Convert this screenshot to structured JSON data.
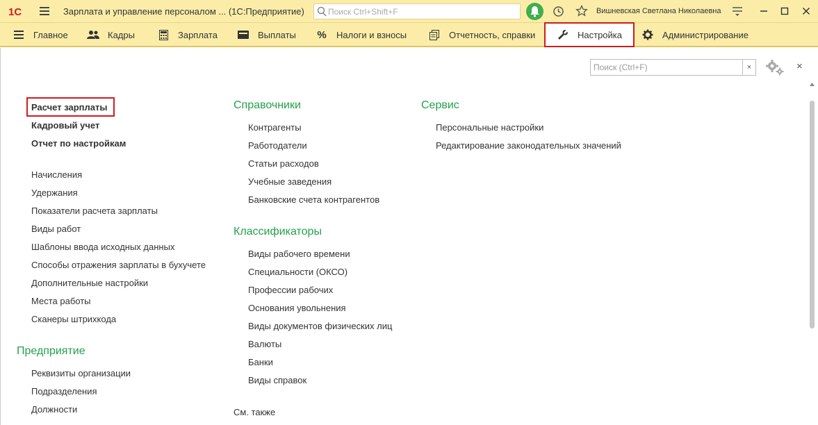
{
  "titlebar": {
    "logo_text": "1С",
    "app_title": "Зарплата и управление персоналом ...  (1С:Предприятие)",
    "search_placeholder": "Поиск Ctrl+Shift+F",
    "user_name": "Вишневская Светлана Николаевна",
    "icons": [
      "menu-icon",
      "notification-bell-icon",
      "history-icon",
      "favorites-star-icon",
      "settings-icon",
      "minimize-icon",
      "maximize-icon",
      "close-icon"
    ]
  },
  "sections": [
    {
      "label": "Главное",
      "icon": "menu-icon"
    },
    {
      "label": "Кадры",
      "icon": "people-icon"
    },
    {
      "label": "Зарплата",
      "icon": "calculator-icon"
    },
    {
      "label": "Выплаты",
      "icon": "wallet-icon"
    },
    {
      "label": "Налоги и взносы",
      "icon": "percent-icon"
    },
    {
      "label": "Отчетность, справки",
      "icon": "reports-icon"
    },
    {
      "label": "Настройка",
      "icon": "wrench-icon",
      "active": true
    },
    {
      "label": "Администрирование",
      "icon": "gear-icon"
    }
  ],
  "panel": {
    "search_placeholder": "Поиск (Ctrl+F)",
    "clear_label": "×",
    "close_label": "×"
  },
  "col1": {
    "top_links": [
      "Расчет зарплаты",
      "Кадровый учет",
      "Отчет по настройкам"
    ],
    "links": [
      "Начисления",
      "Удержания",
      "Показатели расчета зарплаты",
      "Виды работ",
      "Шаблоны ввода исходных данных",
      "Способы отражения зарплаты в бухучете",
      "Дополнительные настройки",
      "Места работы",
      "Сканеры штрихкода"
    ],
    "group_title": "Предприятие",
    "group_links": [
      "Реквизиты организации",
      "Подразделения",
      "Должности"
    ]
  },
  "col2": {
    "group1_title": "Справочники",
    "group1_links": [
      "Контрагенты",
      "Работодатели",
      "Статьи расходов",
      "Учебные заведения",
      "Банковские счета контрагентов"
    ],
    "group2_title": "Классификаторы",
    "group2_links": [
      "Виды рабочего времени",
      "Специальности (ОКСО)",
      "Профессии рабочих",
      "Основания увольнения",
      "Виды документов физических лиц",
      "Валюты",
      "Банки",
      "Виды справок"
    ],
    "see_also": "См. также"
  },
  "col3": {
    "group_title": "Сервис",
    "links": [
      "Персональные настройки",
      "Редактирование законодательных значений"
    ]
  },
  "colors": {
    "accent_green": "#24a04b",
    "highlight_red": "#d11b1b",
    "bar_yellow": "#fbeda8"
  }
}
